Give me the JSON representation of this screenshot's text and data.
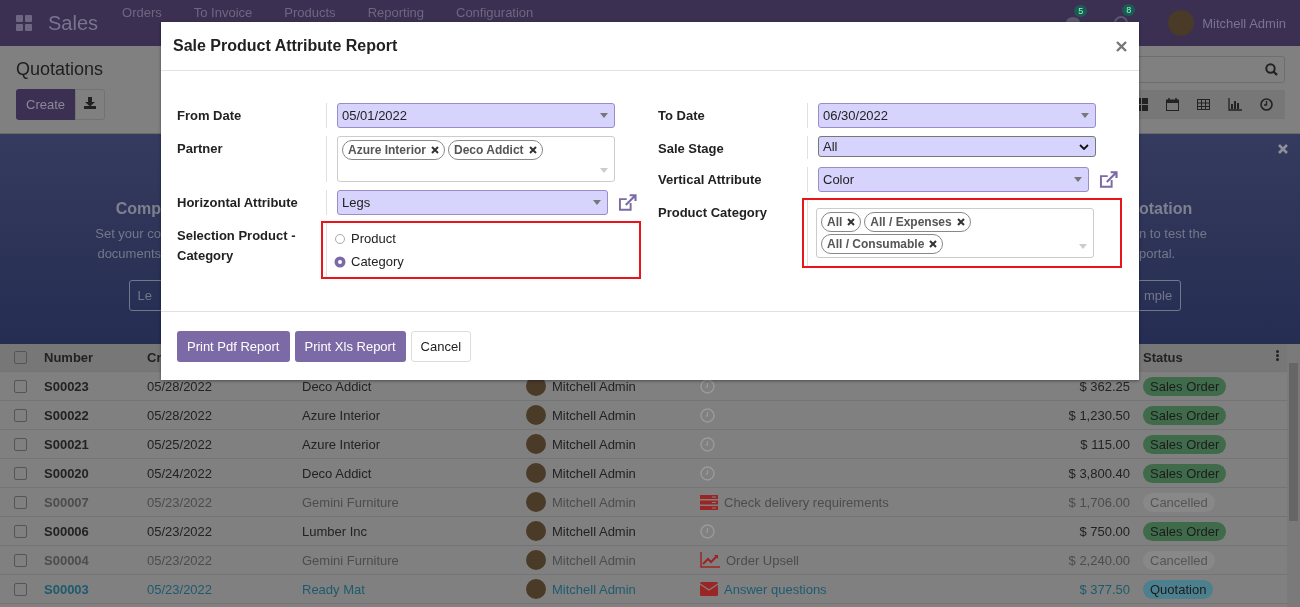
{
  "navbar": {
    "app_name": "Sales",
    "menu": [
      "Orders",
      "To Invoice",
      "Products",
      "Reporting",
      "Configuration"
    ],
    "messages_badge": "5",
    "activities_badge": "8",
    "user": "Mitchell Admin"
  },
  "control_panel": {
    "title": "Quotations",
    "create_button": "Create"
  },
  "banner": {
    "left_title": "Comp",
    "left_lines": [
      "Set your co",
      "documents"
    ],
    "left_button": "Le",
    "right_title": "otation",
    "right_lines": [
      "n to test the",
      "portal."
    ],
    "right_button": "mple"
  },
  "table": {
    "columns": [
      "Number",
      "Cr",
      "Status"
    ],
    "all_checked": false,
    "rows": [
      {
        "number": "S00023",
        "date": "05/28/2022",
        "customer": "Deco Addict",
        "salesperson": "Mitchell Admin",
        "activity": {
          "kind": "clock"
        },
        "total": "$ 362.25",
        "status": "Sales Order",
        "kind": "sale",
        "checked": false
      },
      {
        "number": "S00022",
        "date": "05/28/2022",
        "customer": "Azure Interior",
        "salesperson": "Mitchell Admin",
        "activity": {
          "kind": "clock"
        },
        "total": "$ 1,230.50",
        "status": "Sales Order",
        "kind": "sale",
        "checked": false
      },
      {
        "number": "S00021",
        "date": "05/25/2022",
        "customer": "Azure Interior",
        "salesperson": "Mitchell Admin",
        "activity": {
          "kind": "clock"
        },
        "total": "$ 115.00",
        "status": "Sales Order",
        "kind": "sale",
        "checked": false
      },
      {
        "number": "S00020",
        "date": "05/24/2022",
        "customer": "Deco Addict",
        "salesperson": "Mitchell Admin",
        "activity": {
          "kind": "clock"
        },
        "total": "$ 3,800.40",
        "status": "Sales Order",
        "kind": "sale",
        "checked": false
      },
      {
        "number": "S00007",
        "date": "05/23/2022",
        "customer": "Gemini Furniture",
        "salesperson": "Mitchell Admin",
        "activity": {
          "kind": "todo",
          "text": "Check delivery requirements"
        },
        "total": "$ 1,706.00",
        "status": "Cancelled",
        "kind": "cancel",
        "checked": false
      },
      {
        "number": "S00006",
        "date": "05/23/2022",
        "customer": "Lumber Inc",
        "salesperson": "Mitchell Admin",
        "activity": {
          "kind": "clock"
        },
        "total": "$ 750.00",
        "status": "Sales Order",
        "kind": "sale",
        "checked": false
      },
      {
        "number": "S00004",
        "date": "05/23/2022",
        "customer": "Gemini Furniture",
        "salesperson": "Mitchell Admin",
        "activity": {
          "kind": "upsell",
          "text": "Order Upsell"
        },
        "total": "$ 2,240.00",
        "status": "Cancelled",
        "kind": "cancel",
        "checked": false
      },
      {
        "number": "S00003",
        "date": "05/23/2022",
        "customer": "Ready Mat",
        "salesperson": "Mitchell Admin",
        "activity": {
          "kind": "email",
          "text": "Answer questions"
        },
        "total": "$ 377.50",
        "status": "Quotation",
        "kind": "draft",
        "checked": false
      }
    ]
  },
  "dialog": {
    "title": "Sale Product Attribute Report",
    "left_fields": [
      {
        "kind": "date",
        "label": "From Date",
        "value": "05/01/2022",
        "highlighted": false
      },
      {
        "kind": "tags",
        "label": "Partner",
        "tags": [
          "Azure Interior",
          "Deco Addict"
        ],
        "highlighted": false
      },
      {
        "kind": "select",
        "label": "Horizontal Attribute",
        "value": "Legs",
        "external_link": true,
        "highlighted": false
      },
      {
        "kind": "radio",
        "label": "Selection Product - Category",
        "highlighted": true,
        "options": [
          {
            "label": "Product",
            "selected": false
          },
          {
            "label": "Category",
            "selected": true
          }
        ]
      }
    ],
    "right_fields": [
      {
        "kind": "date",
        "label": "To Date",
        "value": "06/30/2022",
        "highlighted": false
      },
      {
        "kind": "native_select",
        "label": "Sale Stage",
        "value": "All",
        "highlighted": false
      },
      {
        "kind": "select",
        "label": "Vertical Attribute",
        "value": "Color",
        "external_link": true,
        "highlighted": false
      },
      {
        "kind": "tags",
        "label": "Product Category",
        "tags": [
          "All",
          "All / Expenses",
          "All / Consumable"
        ],
        "highlighted": true
      }
    ],
    "buttons": [
      {
        "label": "Print Pdf Report",
        "kind": "primary"
      },
      {
        "label": "Print Xls Report",
        "kind": "primary"
      },
      {
        "label": "Cancel",
        "kind": "secondary"
      }
    ]
  }
}
